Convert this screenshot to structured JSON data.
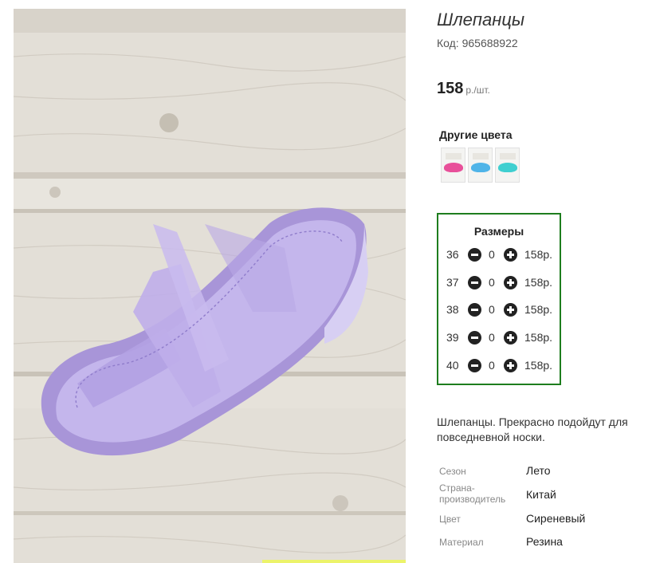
{
  "product": {
    "title": "Шлепанцы",
    "code_label": "Код: 965688922",
    "price_value": "158",
    "price_unit": "р./шт."
  },
  "other_colors": {
    "title": "Другие цвета",
    "swatches": [
      {
        "name": "pink",
        "color": "#e8509a"
      },
      {
        "name": "blue",
        "color": "#4fb4e8"
      },
      {
        "name": "turquoise",
        "color": "#3fcfd0"
      }
    ]
  },
  "sizes": {
    "title": "Размеры",
    "rows": [
      {
        "size": "36",
        "qty": "0",
        "price": "158р."
      },
      {
        "size": "37",
        "qty": "0",
        "price": "158р."
      },
      {
        "size": "38",
        "qty": "0",
        "price": "158р."
      },
      {
        "size": "39",
        "qty": "0",
        "price": "158р."
      },
      {
        "size": "40",
        "qty": "0",
        "price": "158р."
      }
    ],
    "border_color": "#1e7d1e"
  },
  "description": "Шлепанцы. Прекрасно подойдут для повседневной носки.",
  "properties": [
    {
      "key": "Сезон",
      "value": "Лето"
    },
    {
      "key": "Страна-производитель",
      "value": "Китай"
    },
    {
      "key": "Цвет",
      "value": "Сиреневый"
    },
    {
      "key": "Материал",
      "value": "Резина"
    }
  ],
  "colors": {
    "shoe": "#b9a6e6",
    "wood": "#ddd9d0"
  }
}
